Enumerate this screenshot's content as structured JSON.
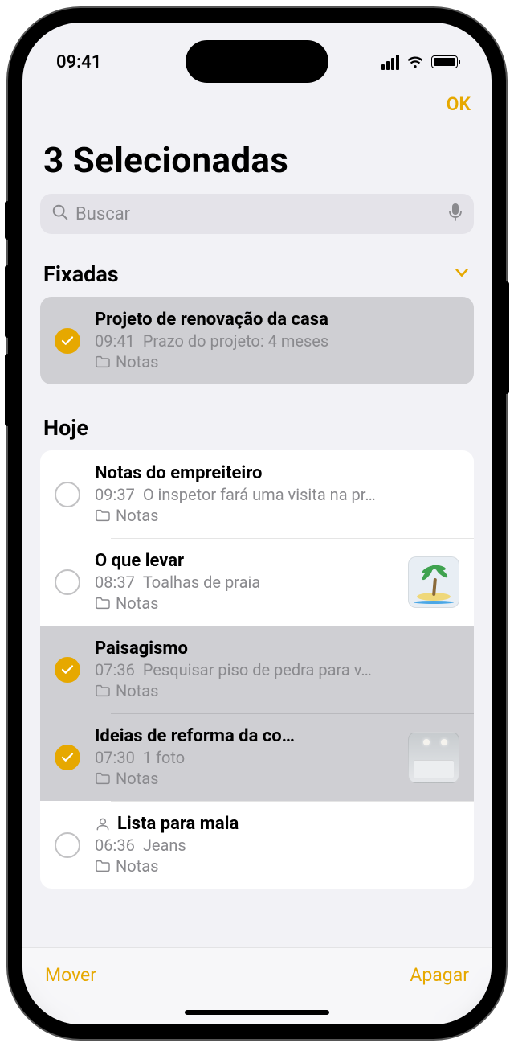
{
  "status": {
    "time": "09:41"
  },
  "nav": {
    "done": "OK"
  },
  "title": "3 Selecionadas",
  "search": {
    "placeholder": "Buscar"
  },
  "sections": {
    "pinned": {
      "title": "Fixadas"
    },
    "today": {
      "title": "Hoje"
    }
  },
  "notes": {
    "pinned": [
      {
        "title": "Projeto de renovação da casa",
        "time": "09:41",
        "preview": "Prazo do projeto: 4 meses",
        "folder": "Notas",
        "selected": true
      }
    ],
    "today": [
      {
        "title": "Notas do empreiteiro",
        "time": "09:37",
        "preview": "O inspetor fará uma visita na pr…",
        "folder": "Notas",
        "selected": false
      },
      {
        "title": "O que levar",
        "time": "08:37",
        "preview": "Toalhas de praia",
        "folder": "Notas",
        "selected": false,
        "thumb": "palm"
      },
      {
        "title": "Paisagismo",
        "time": "07:36",
        "preview": "Pesquisar piso de pedra para v…",
        "folder": "Notas",
        "selected": true
      },
      {
        "title": "Ideias de reforma da co…",
        "time": "07:30",
        "preview": "1 foto",
        "folder": "Notas",
        "selected": true,
        "thumb": "kitchen"
      },
      {
        "title": "Lista para mala",
        "time": "06:36",
        "preview": "Jeans",
        "folder": "Notas",
        "selected": false,
        "shared": true
      }
    ]
  },
  "toolbar": {
    "move": "Mover",
    "delete": "Apagar"
  }
}
